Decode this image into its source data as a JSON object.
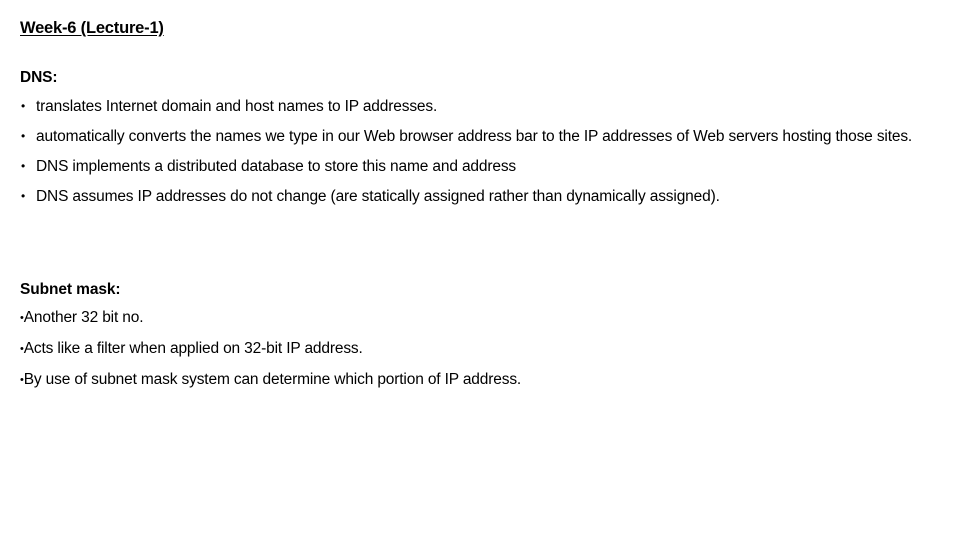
{
  "slide": {
    "title": "Week-6 (Lecture-1)",
    "background_color": "#ffffff",
    "text_color": "#000000"
  },
  "sections": [
    {
      "heading": "DNS:",
      "bullet_glyph": "•",
      "items": [
        "translates Internet domain and host names to IP addresses.",
        "automatically converts the names we type in our Web browser address bar to the IP addresses of Web servers hosting those sites.",
        "DNS implements a distributed database to store this name and address",
        "DNS assumes IP addresses do not change (are statically assigned rather than dynamically assigned)."
      ]
    },
    {
      "heading": "Subnet mask:",
      "bullet_glyph": "•",
      "items": [
        "Another 32 bit no.",
        "Acts like a filter when applied on 32-bit IP address.",
        "By use of subnet mask system can determine which portion of IP address."
      ]
    }
  ]
}
